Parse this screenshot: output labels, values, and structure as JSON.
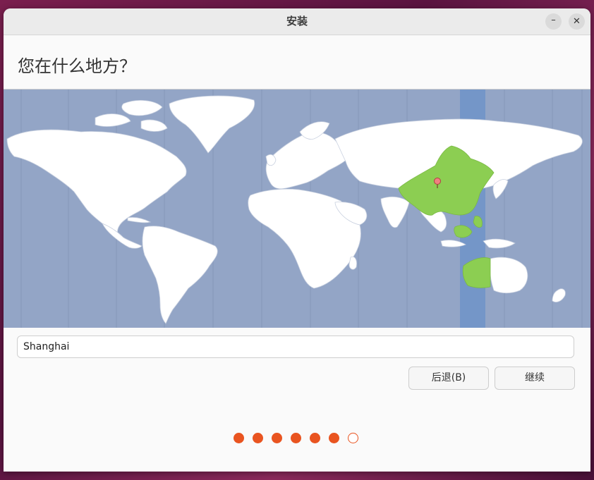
{
  "window": {
    "title": "安装",
    "minimize_glyph": "–",
    "close_glyph": "✕"
  },
  "heading": "您在什么地方？",
  "timezone": {
    "value": "Shanghai",
    "placeholder": ""
  },
  "buttons": {
    "back_label": "后退(B)",
    "continue_label": "继续"
  },
  "progress": {
    "total_steps": 7,
    "completed_steps": 6
  },
  "colors": {
    "accent": "#e95420",
    "ocean": "#93a5c6",
    "selected_zone_band": "#7496c8",
    "selected_region": "#8cce52",
    "land": "#ffffff"
  },
  "map": {
    "selected_city": "Shanghai"
  }
}
